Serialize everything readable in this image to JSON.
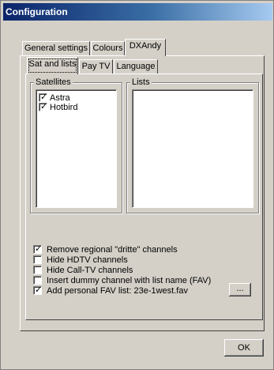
{
  "window": {
    "title": "Configuration"
  },
  "outer_tabs": [
    {
      "label": "General settings"
    },
    {
      "label": "Colours"
    },
    {
      "label": "DXAndy",
      "active": true
    }
  ],
  "inner_tabs": [
    {
      "label": "Sat and lists",
      "active": true
    },
    {
      "label": "Pay TV"
    },
    {
      "label": "Language"
    }
  ],
  "satellites": {
    "label": "Satellites",
    "items": [
      {
        "name": "Astra",
        "checked": true
      },
      {
        "name": "Hotbird",
        "checked": true
      }
    ]
  },
  "lists": {
    "label": "Lists",
    "items": []
  },
  "options": [
    {
      "label": "Remove regional \"dritte\" channels",
      "checked": true
    },
    {
      "label": "Hide HDTV channels",
      "checked": false
    },
    {
      "label": "Hide Call-TV channels",
      "checked": false
    },
    {
      "label": "Insert dummy channel with list name (FAV)",
      "checked": false
    },
    {
      "label": "Add personal FAV list: 23e-1west.fav",
      "checked": true
    }
  ],
  "browse_button": {
    "label": "..."
  },
  "ok_button": {
    "label": "OK"
  }
}
